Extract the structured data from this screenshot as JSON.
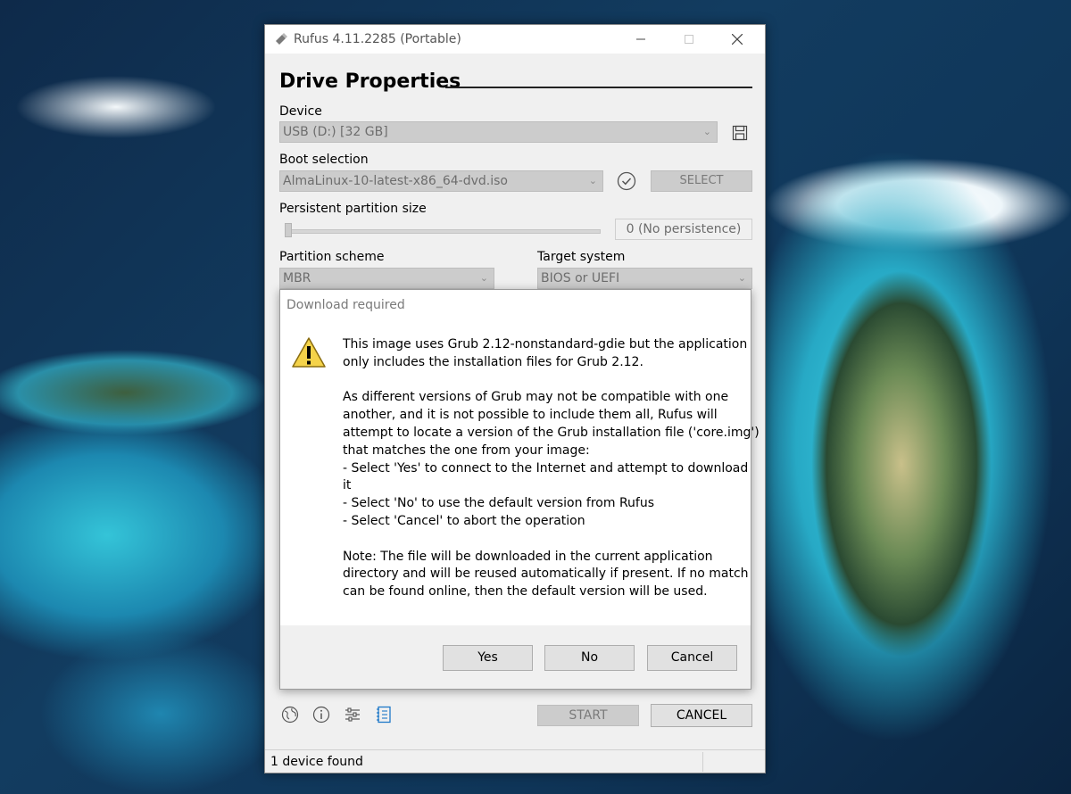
{
  "window": {
    "title": "Rufus 4.11.2285 (Portable)",
    "heading": "Drive Properties"
  },
  "device": {
    "label": "Device",
    "value": "USB (D:) [32 GB]"
  },
  "boot_selection": {
    "label": "Boot selection",
    "value": "AlmaLinux-10-latest-x86_64-dvd.iso",
    "select_button": "SELECT"
  },
  "persistent_partition": {
    "label": "Persistent partition size",
    "value": "0 (No persistence)",
    "slider_fraction": 0
  },
  "partition_scheme": {
    "label": "Partition scheme",
    "value": "MBR"
  },
  "target_system": {
    "label": "Target system",
    "value": "BIOS or UEFI"
  },
  "footer": {
    "start_button": "START",
    "cancel_button": "CANCEL",
    "icons": [
      "globe-icon",
      "info-icon",
      "settings-icon",
      "log-icon"
    ]
  },
  "status_bar": {
    "text": "1 device found"
  },
  "dialog": {
    "title": "Download required",
    "icon": "warning-icon",
    "lines_p1": [
      "This image uses Grub 2.12-nonstandard-gdie but the application",
      "only includes the installation files for Grub 2.12."
    ],
    "lines_p2": [
      "As different versions of Grub may not be compatible with one",
      "another, and it is not possible to include them all, Rufus will",
      "attempt to locate a version of the Grub installation file ('core.img')",
      "that matches the one from your image:",
      "- Select 'Yes' to connect to the Internet and attempt to download",
      "it",
      "- Select 'No' to use the default version from Rufus",
      "- Select 'Cancel' to abort the operation"
    ],
    "lines_p3": [
      "Note: The file will be downloaded in the current application",
      "directory and will be reused automatically if present. If no match",
      "can be found online, then the default version will be used."
    ],
    "buttons": {
      "yes": "Yes",
      "no": "No",
      "cancel": "Cancel"
    }
  },
  "colors": {
    "window_bg": "#f0f0f0",
    "disabled_control": "#cccccc",
    "accent_log_icon": "#1e78c8"
  }
}
